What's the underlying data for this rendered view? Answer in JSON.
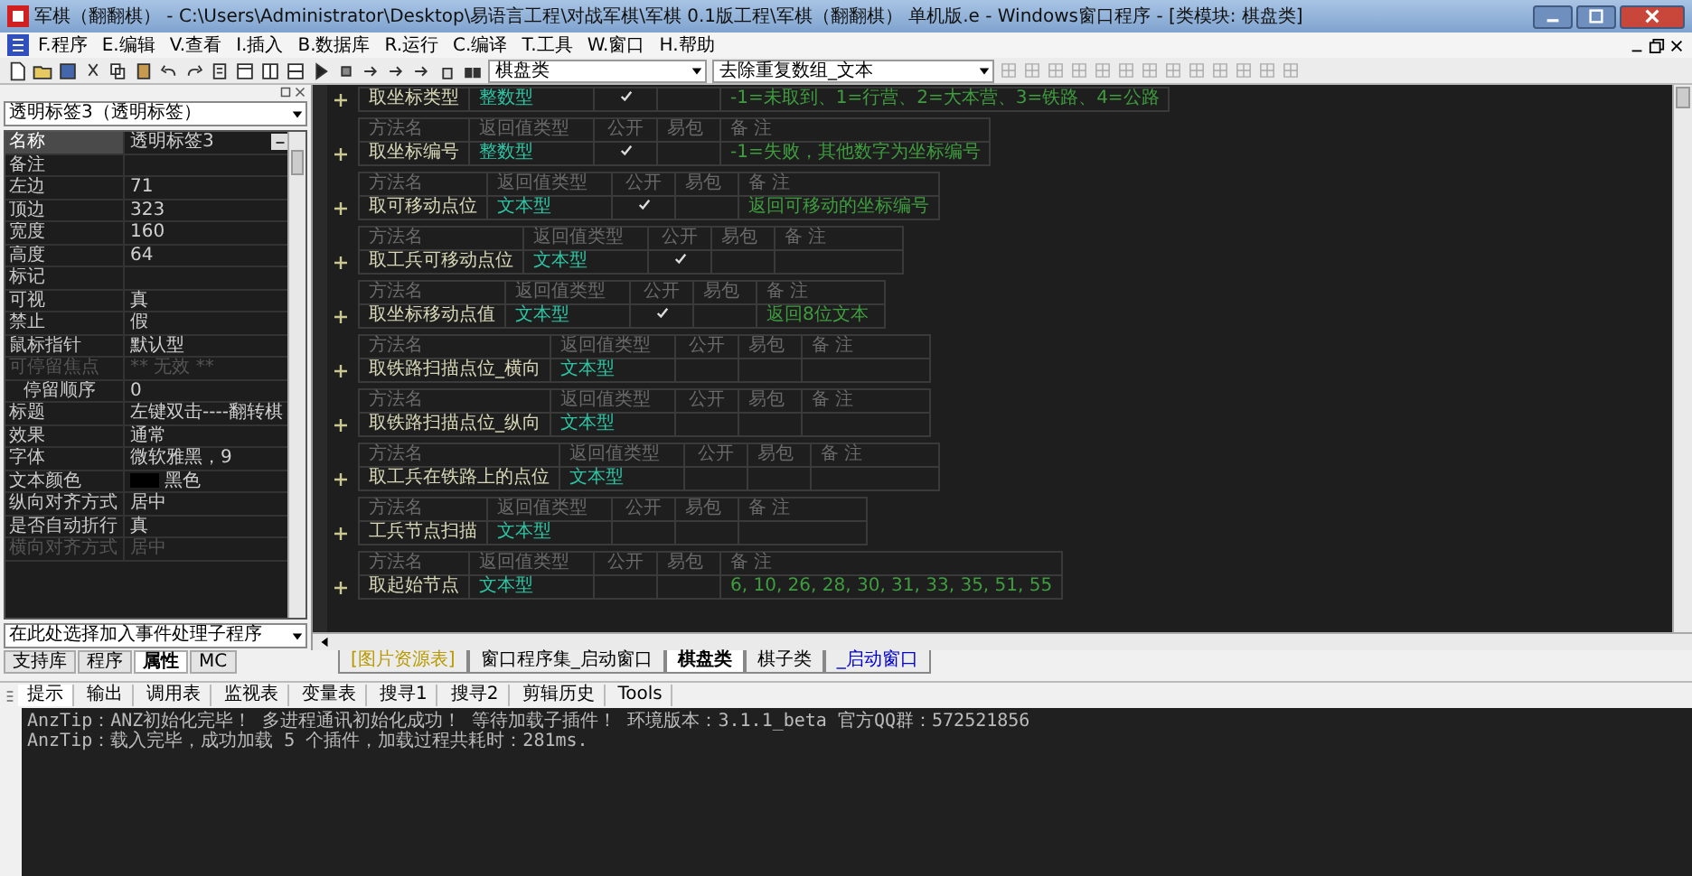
{
  "window": {
    "title": "军棋（翻翻棋） - C:\\Users\\Administrator\\Desktop\\易语言工程\\对战军棋\\军棋 0.1版工程\\军棋（翻翻棋） 单机版.e - Windows窗口程序 - [类模块: 棋盘类]"
  },
  "menu": [
    "F.程序",
    "E.编辑",
    "V.查看",
    "I.插入",
    "B.数据库",
    "R.运行",
    "C.编译",
    "T.工具",
    "W.窗口",
    "H.帮助"
  ],
  "toolbar": {
    "class_combo": "棋盘类",
    "method_combo": "去除重复数组_文本"
  },
  "properties": {
    "object_combo": "透明标签3（透明标签）",
    "event_combo": "在此处选择加入事件处理子程序",
    "rows": [
      {
        "name": "名称",
        "value": "透明标签3",
        "kind": "dialog",
        "selected": true,
        "disabled": false
      },
      {
        "name": "备注",
        "kind": "text",
        "selected": false,
        "disabled": false
      },
      {
        "name": "左边",
        "value": "71",
        "kind": "text",
        "selected": false,
        "disabled": false
      },
      {
        "name": "顶边",
        "value": "323",
        "kind": "text",
        "selected": false,
        "disabled": false
      },
      {
        "name": "宽度",
        "value": "160",
        "kind": "text",
        "selected": false,
        "disabled": false
      },
      {
        "name": "高度",
        "value": "64",
        "kind": "text",
        "selected": false,
        "disabled": false
      },
      {
        "name": "标记",
        "kind": "text",
        "selected": false,
        "disabled": false
      },
      {
        "name": "可视",
        "value": "真",
        "kind": "text",
        "selected": false,
        "disabled": false
      },
      {
        "name": "禁止",
        "value": "假",
        "kind": "text",
        "selected": false,
        "disabled": false
      },
      {
        "name": "鼠标指针",
        "value": "默认型",
        "kind": "text",
        "selected": false,
        "disabled": false
      },
      {
        "name": "可停留焦点",
        "value": "** 无效 **",
        "kind": "text",
        "selected": false,
        "disabled": true,
        "children": [
          {
            "name": "停留顺序",
            "value": "0",
            "kind": "text",
            "selected": false,
            "disabled": false
          }
        ]
      },
      {
        "name": "标题",
        "value": "左键双击----翻转棋",
        "kind": "text",
        "selected": false,
        "disabled": false
      },
      {
        "name": "效果",
        "value": "通常",
        "kind": "text",
        "selected": false,
        "disabled": false
      },
      {
        "name": "字体",
        "value": "微软雅黑，9",
        "kind": "text",
        "selected": false,
        "disabled": false
      },
      {
        "name": "文本颜色",
        "value": "黑色",
        "kind": "color",
        "color": "#000000",
        "selected": false,
        "disabled": false
      },
      {
        "name": "纵向对齐方式",
        "value": "居中",
        "kind": "text",
        "selected": false,
        "disabled": false
      },
      {
        "name": "是否自动折行",
        "value": "真",
        "kind": "text",
        "selected": false,
        "disabled": false
      },
      {
        "name": "横向对齐方式",
        "value": "居中",
        "kind": "text",
        "selected": false,
        "disabled": true
      }
    ]
  },
  "methods": [
    {
      "name": "取坐标类型",
      "type": "整数型",
      "public": true,
      "note": "-1=未取到、1=行营、2=大本营、3=铁路、4=公路"
    },
    {
      "columns": [
        "方法名",
        "返回值类型",
        "公开",
        "易包",
        "备 注"
      ],
      "name": "取坐标编号",
      "type": "整数型",
      "public": true,
      "note": "-1=失败，其他数字为坐标编号"
    },
    {
      "columns": [
        "方法名",
        "返回值类型",
        "公开",
        "易包",
        "备 注"
      ],
      "name": "取可移动点位",
      "type": "文本型",
      "public": true,
      "note": "返回可移动的坐标编号"
    },
    {
      "columns": [
        "方法名",
        "返回值类型",
        "公开",
        "易包",
        "备 注"
      ],
      "name": "取工兵可移动点位",
      "type": "文本型",
      "public": true
    },
    {
      "columns": [
        "方法名",
        "返回值类型",
        "公开",
        "易包",
        "备 注"
      ],
      "name": "取坐标移动点值",
      "type": "文本型",
      "public": true,
      "note": "返回8位文本"
    },
    {
      "columns": [
        "方法名",
        "返回值类型",
        "公开",
        "易包",
        "备 注"
      ],
      "name": "取铁路扫描点位_横向",
      "type": "文本型",
      "public": false
    },
    {
      "columns": [
        "方法名",
        "返回值类型",
        "公开",
        "易包",
        "备 注"
      ],
      "name": "取铁路扫描点位_纵向",
      "type": "文本型",
      "public": false
    },
    {
      "columns": [
        "方法名",
        "返回值类型",
        "公开",
        "易包",
        "备 注"
      ],
      "name": "取工兵在铁路上的点位",
      "type": "文本型",
      "public": false
    },
    {
      "columns": [
        "方法名",
        "返回值类型",
        "公开",
        "易包",
        "备 注"
      ],
      "name": "工兵节点扫描",
      "type": "文本型",
      "public": false
    },
    {
      "columns": [
        "方法名",
        "返回值类型",
        "公开",
        "易包",
        "备 注"
      ],
      "name": "取起始节点",
      "type": "文本型",
      "public": false,
      "note": "6, 10, 26, 28, 30, 31, 33, 35, 51, 55"
    }
  ],
  "left_tabs": [
    {
      "label": "支持库",
      "selected": false
    },
    {
      "label": "程序",
      "selected": false
    },
    {
      "label": "属性",
      "selected": true
    },
    {
      "label": "MC",
      "selected": false
    }
  ],
  "editor_tabs": [
    {
      "label": "[图片资源表]",
      "selected": false,
      "color": "#b89a00"
    },
    {
      "label": "窗口程序集_启动窗口",
      "selected": false,
      "color": "#000000"
    },
    {
      "label": "棋盘类",
      "selected": true,
      "color": "#000000"
    },
    {
      "label": "棋子类",
      "selected": false,
      "color": "#000000"
    },
    {
      "label": "_启动窗口",
      "selected": false,
      "color": "#0000cc"
    }
  ],
  "output_tabs": [
    {
      "label": "提示",
      "selected": true
    },
    {
      "label": "输出",
      "selected": false
    },
    {
      "label": "调用表",
      "selected": false
    },
    {
      "label": "监视表",
      "selected": false
    },
    {
      "label": "变量表",
      "selected": false
    },
    {
      "label": "搜寻1",
      "selected": false
    },
    {
      "label": "搜寻2",
      "selected": false
    },
    {
      "label": "剪辑历史",
      "selected": false
    },
    {
      "label": "Tools",
      "selected": false
    }
  ],
  "output_lines": [
    "AnzTip：ANZ初始化完毕！ 多进程通讯初始化成功！ 等待加载子插件！ 环境版本：3.1.1_beta 官方QQ群：572521856",
    "AnzTip：载入完毕，成功加载 5 个插件，加载过程共耗时：281ms."
  ]
}
